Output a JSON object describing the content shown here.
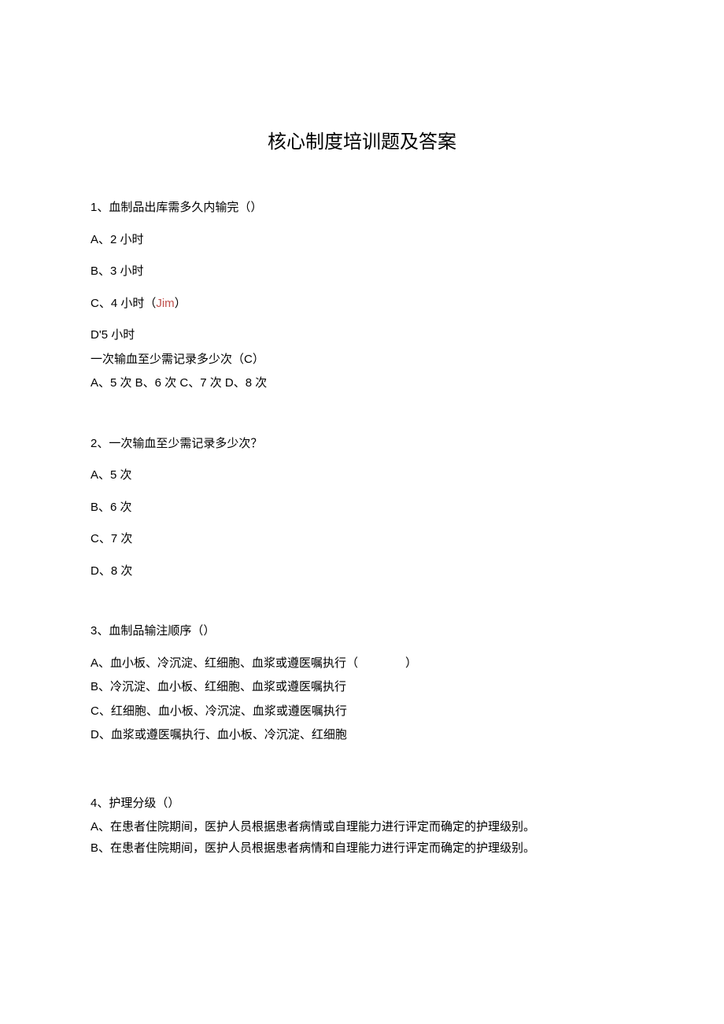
{
  "title": "核心制度培训题及答案",
  "q1": {
    "prompt": "1、血制品出库需多久内输完（）",
    "optA": "A、2 小时",
    "optB": "B、3 小时",
    "optC_prefix": "C、4 小时（",
    "optC_jim": "Jim",
    "optC_suffix": "）",
    "optD": "D'5 小时",
    "extra1": "一次输血至少需记录多少次（C）",
    "extra2": "A、5 次 B、6 次 C、7 次 D、8 次"
  },
  "q2": {
    "prompt": "2、一次输血至少需记录多少次？",
    "optA": "A、5 次",
    "optB": "B、6 次",
    "optC": "C、7 次",
    "optD": "D、8 次"
  },
  "q3": {
    "prompt": "3、血制品输注顺序（）",
    "optA": "A、血小板、冷沉淀、红细胞、血浆或遵医嘱执行（　　　　）",
    "optB": "B、冷沉淀、血小板、红细胞、血浆或遵医嘱执行",
    "optC": "C、红细胞、血小板、冷沉淀、血浆或遵医嘱执行",
    "optD": "D、血浆或遵医嘱执行、血小板、冷沉淀、红细胞"
  },
  "q4": {
    "prompt": "4、护理分级（）",
    "optA": "A、在患者住院期间，医护人员根据患者病情或自理能力进行评定而确定的护理级别。",
    "optB": "B、在患者住院期间，医护人员根据患者病情和自理能力进行评定而确定的护理级别。"
  }
}
